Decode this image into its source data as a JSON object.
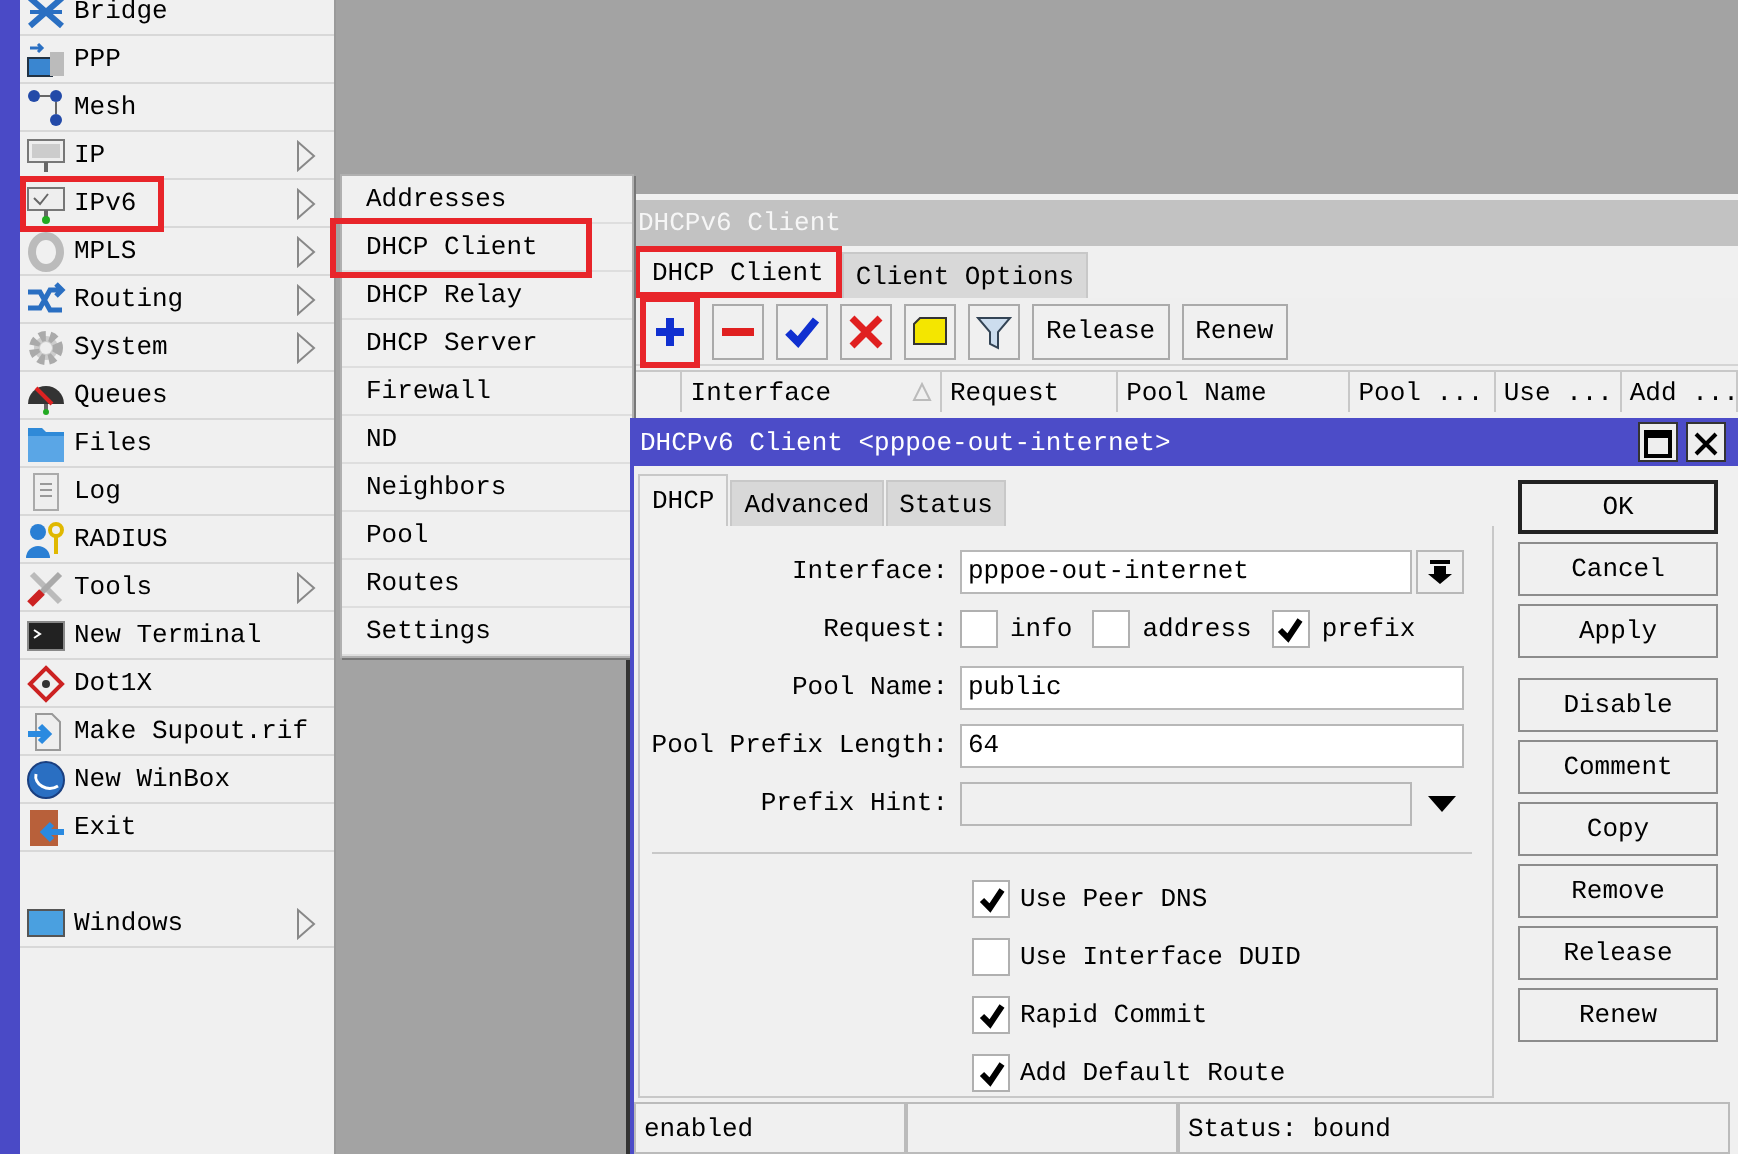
{
  "sidebar": {
    "items": [
      {
        "label": "Bridge",
        "has_submenu": false,
        "annotated": false
      },
      {
        "label": "PPP",
        "has_submenu": false,
        "annotated": false
      },
      {
        "label": "Mesh",
        "has_submenu": false,
        "annotated": false
      },
      {
        "label": "IP",
        "has_submenu": true,
        "annotated": false
      },
      {
        "label": "IPv6",
        "has_submenu": true,
        "annotated": true
      },
      {
        "label": "MPLS",
        "has_submenu": true,
        "annotated": false
      },
      {
        "label": "Routing",
        "has_submenu": true,
        "annotated": false
      },
      {
        "label": "System",
        "has_submenu": true,
        "annotated": false
      },
      {
        "label": "Queues",
        "has_submenu": false,
        "annotated": false
      },
      {
        "label": "Files",
        "has_submenu": false,
        "annotated": false
      },
      {
        "label": "Log",
        "has_submenu": false,
        "annotated": false
      },
      {
        "label": "RADIUS",
        "has_submenu": false,
        "annotated": false
      },
      {
        "label": "Tools",
        "has_submenu": true,
        "annotated": false
      },
      {
        "label": "New Terminal",
        "has_submenu": false,
        "annotated": false
      },
      {
        "label": "Dot1X",
        "has_submenu": false,
        "annotated": false
      },
      {
        "label": "Make Supout.rif",
        "has_submenu": false,
        "annotated": false
      },
      {
        "label": "New WinBox",
        "has_submenu": false,
        "annotated": false
      },
      {
        "label": "Exit",
        "has_submenu": false,
        "annotated": false
      },
      {
        "label": "Windows",
        "has_submenu": true,
        "annotated": false,
        "gap_before": true
      }
    ]
  },
  "submenu": {
    "items": [
      {
        "label": "Addresses",
        "annotated": false
      },
      {
        "label": "DHCP Client",
        "annotated": true
      },
      {
        "label": "DHCP Relay",
        "annotated": false
      },
      {
        "label": "DHCP Server",
        "annotated": false
      },
      {
        "label": "Firewall",
        "annotated": false
      },
      {
        "label": "ND",
        "annotated": false
      },
      {
        "label": "Neighbors",
        "annotated": false
      },
      {
        "label": "Pool",
        "annotated": false
      },
      {
        "label": "Routes",
        "annotated": false
      },
      {
        "label": "Settings",
        "annotated": false
      }
    ]
  },
  "list_window": {
    "title": "DHCPv6 Client",
    "active": false,
    "tabs": [
      {
        "label": "DHCP Client",
        "selected": true,
        "annotated": true
      },
      {
        "label": "Client Options",
        "selected": false,
        "annotated": false
      }
    ],
    "toolbar": [
      {
        "kind": "add",
        "annotated": true
      },
      {
        "kind": "remove"
      },
      {
        "kind": "enable"
      },
      {
        "kind": "disable"
      },
      {
        "kind": "comment"
      },
      {
        "kind": "filter"
      },
      {
        "kind": "text",
        "label": "Release"
      },
      {
        "kind": "text",
        "label": "Renew"
      }
    ],
    "columns": [
      {
        "label": "Interface",
        "sorted": true
      },
      {
        "label": "Request",
        "sorted": false
      },
      {
        "label": "Pool Name",
        "sorted": false
      },
      {
        "label": "Pool ...",
        "sorted": false
      },
      {
        "label": "Use ...",
        "sorted": false
      },
      {
        "label": "Add ...",
        "sorted": false
      }
    ]
  },
  "dialog": {
    "title": "DHCPv6 Client <pppoe-out-internet>",
    "active": true,
    "tabs": [
      {
        "label": "DHCP",
        "selected": true
      },
      {
        "label": "Advanced",
        "selected": false
      },
      {
        "label": "Status",
        "selected": false
      }
    ],
    "fields": [
      {
        "kind": "dropdown",
        "label": "Interface:",
        "value": "pppoe-out-internet"
      },
      {
        "kind": "checks",
        "label": "Request:",
        "options": [
          {
            "label": "info",
            "checked": false
          },
          {
            "label": "address",
            "checked": false
          },
          {
            "label": "prefix",
            "checked": true
          }
        ]
      },
      {
        "kind": "text",
        "label": "Pool Name:",
        "value": "public"
      },
      {
        "kind": "text",
        "label": "Pool Prefix Length:",
        "value": "64"
      },
      {
        "kind": "combo",
        "label": "Prefix Hint:"
      }
    ],
    "options": [
      {
        "label": "Use Peer DNS",
        "checked": true
      },
      {
        "label": "Use Interface DUID",
        "checked": false
      },
      {
        "label": "Rapid Commit",
        "checked": true
      },
      {
        "label": "Add Default Route",
        "checked": true
      }
    ],
    "button_groups": [
      {
        "buttons": [
          {
            "label": "OK",
            "default": true
          },
          {
            "label": "Cancel",
            "default": false
          },
          {
            "label": "Apply",
            "default": false
          }
        ]
      },
      {
        "buttons": [
          {
            "label": "Disable",
            "default": false
          },
          {
            "label": "Comment",
            "default": false
          },
          {
            "label": "Copy",
            "default": false
          },
          {
            "label": "Remove",
            "default": false
          },
          {
            "label": "Release",
            "default": false
          },
          {
            "label": "Renew",
            "default": false
          }
        ]
      }
    ],
    "status_bar": {
      "state": "enabled",
      "status": "Status: bound"
    }
  }
}
